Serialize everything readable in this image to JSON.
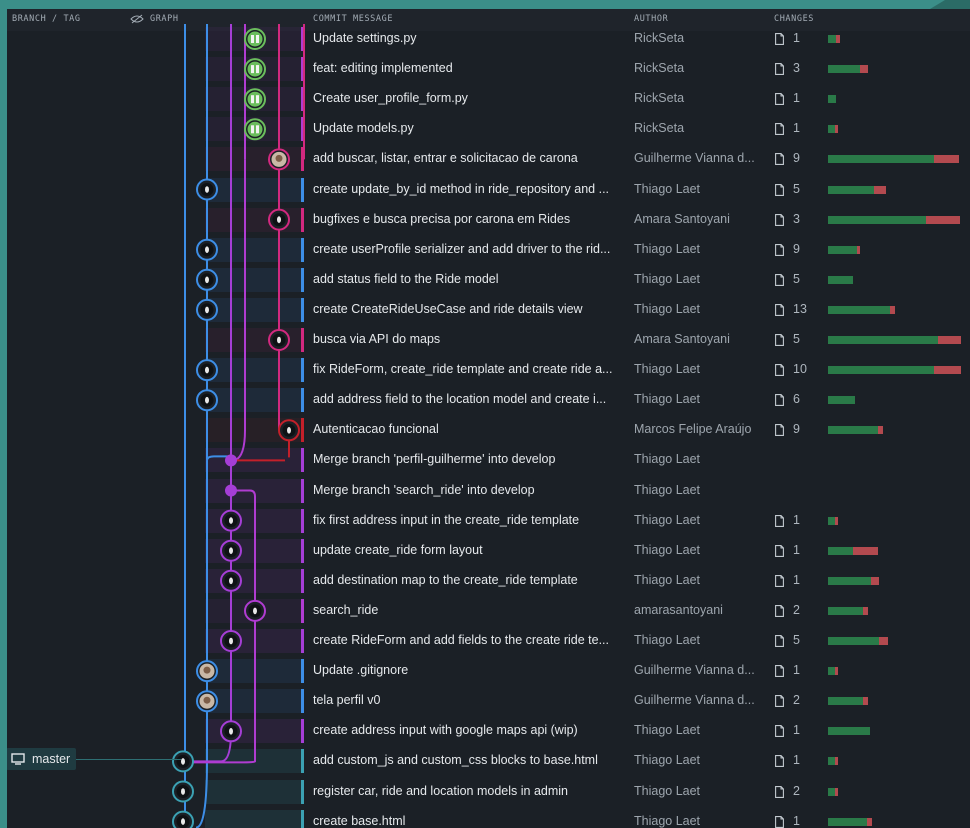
{
  "header": {
    "branch_tag": "BRANCH / TAG",
    "graph": "GRAPH",
    "commit_message": "COMMIT MESSAGE",
    "author": "AUTHOR",
    "changes": "CHANGES"
  },
  "branch": {
    "label": "master"
  },
  "colors": {
    "green": "#2a7a48",
    "red": "#b34a4f",
    "teal": "#3b8f89"
  },
  "commits": [
    {
      "message": "Update settings.py",
      "author": "RickSeta",
      "changes": "1",
      "add": 0.06,
      "del": 0.03
    },
    {
      "message": "feat: editing implemented",
      "author": "RickSeta",
      "changes": "3",
      "add": 0.24,
      "del": 0.06
    },
    {
      "message": "Create user_profile_form.py",
      "author": "RickSeta",
      "changes": "1",
      "add": 0.06,
      "del": 0
    },
    {
      "message": "Update models.py",
      "author": "RickSeta",
      "changes": "1",
      "add": 0.05,
      "del": 0.02
    },
    {
      "message": "add buscar, listar, entrar e solicitacao de carona",
      "author": "Guilherme Vianna d...",
      "changes": "9",
      "add": 0.79,
      "del": 0.19
    },
    {
      "message": "create update_by_id method in ride_repository and ...",
      "author": "Thiago Laet",
      "changes": "5",
      "add": 0.34,
      "del": 0.09
    },
    {
      "message": "bugfixes e busca precisa por carona em Rides",
      "author": "Amara Santoyani",
      "changes": "3",
      "add": 0.73,
      "del": 0.25
    },
    {
      "message": "create userProfile serializer and add driver to the rid...",
      "author": "Thiago Laet",
      "changes": "9",
      "add": 0.22,
      "del": 0.02
    },
    {
      "message": "add status field to the Ride model",
      "author": "Thiago Laet",
      "changes": "5",
      "add": 0.19,
      "del": 0
    },
    {
      "message": "create CreateRideUseCase and ride details view",
      "author": "Thiago Laet",
      "changes": "13",
      "add": 0.46,
      "del": 0.04
    },
    {
      "message": "busca via API do maps",
      "author": "Amara Santoyani",
      "changes": "5",
      "add": 0.82,
      "del": 0.17
    },
    {
      "message": "fix RideForm, create_ride template and create ride a...",
      "author": "Thiago Laet",
      "changes": "10",
      "add": 0.79,
      "del": 0.2
    },
    {
      "message": "add address field to the location model and create i...",
      "author": "Thiago Laet",
      "changes": "6",
      "add": 0.2,
      "del": 0
    },
    {
      "message": "Autenticacao funcional",
      "author": "Marcos Felipe Araújo",
      "changes": "9",
      "add": 0.37,
      "del": 0.04
    },
    {
      "message": "Merge branch 'perfil-guilherme' into develop",
      "author": "Thiago Laet",
      "changes": "",
      "add": 0,
      "del": 0
    },
    {
      "message": "Merge branch 'search_ride' into develop",
      "author": "Thiago Laet",
      "changes": "",
      "add": 0,
      "del": 0
    },
    {
      "message": "fix first address input in the create_ride template",
      "author": "Thiago Laet",
      "changes": "1",
      "add": 0.05,
      "del": 0.02
    },
    {
      "message": "update create_ride form layout",
      "author": "Thiago Laet",
      "changes": "1",
      "add": 0.19,
      "del": 0.19
    },
    {
      "message": "add destination map to the create_ride template",
      "author": "Thiago Laet",
      "changes": "1",
      "add": 0.32,
      "del": 0.06
    },
    {
      "message": "search_ride",
      "author": "amarasantoyani",
      "changes": "2",
      "add": 0.26,
      "del": 0.04
    },
    {
      "message": "create RideForm and add fields to the create ride te...",
      "author": "Thiago Laet",
      "changes": "5",
      "add": 0.38,
      "del": 0.07
    },
    {
      "message": "Update .gitignore",
      "author": "Guilherme Vianna d...",
      "changes": "1",
      "add": 0.05,
      "del": 0.02
    },
    {
      "message": "tela perfil v0",
      "author": "Guilherme Vianna d...",
      "changes": "2",
      "add": 0.26,
      "del": 0.04
    },
    {
      "message": "create address input with google maps api (wip)",
      "author": "Thiago Laet",
      "changes": "1",
      "add": 0.31,
      "del": 0
    },
    {
      "message": "add custom_js and custom_css blocks to base.html",
      "author": "Thiago Laet",
      "changes": "1",
      "add": 0.05,
      "del": 0.02
    },
    {
      "message": "register car, ride and location models in admin",
      "author": "Thiago Laet",
      "changes": "2",
      "add": 0.05,
      "del": 0.02
    },
    {
      "message": "create base.html",
      "author": "Thiago Laet",
      "changes": "1",
      "add": 0.29,
      "del": 0.04
    }
  ]
}
